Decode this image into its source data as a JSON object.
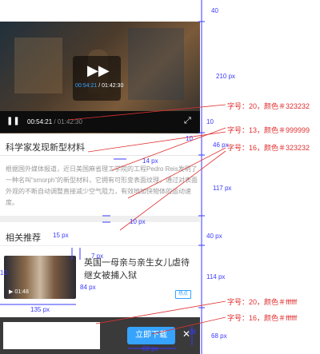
{
  "video": {
    "center_time_current": "00:54:21",
    "center_time_total": "01:42:30",
    "bar_time_current": "00:54:21",
    "bar_time_separator": " / ",
    "bar_time_total": "01:42:30",
    "play_icon": "play-icon",
    "pause_icon": "pause-icon",
    "fullscreen_icon": "fullscreen-icon",
    "progress_fraction": 0.45
  },
  "article": {
    "title": "科学家发现新型材料",
    "body": "根据国外媒体报道，近日美国麻省理工学院的工程Pedro Reis发明了一种名叫“smorph”的新型材料，它拥有可形变表面纹理，通过对表面外观的不断自动调整直接减少空气阻力，有效地加快物体的运动速度。"
  },
  "related": {
    "heading": "相关推荐",
    "item": {
      "title": "英国一母亲与亲生女儿虐待继女被捕入狱",
      "duration": "01:48",
      "tag": "热点"
    }
  },
  "bottom_bar": {
    "download_label": "立即下载",
    "close_icon": "close-icon"
  },
  "annotations": {
    "h40_top": "40",
    "h210": "210 px",
    "h10_a": "10",
    "h10_b": "10",
    "h46": "46 px",
    "h117": "117 px",
    "h10_c": "10 px",
    "h14": "14 px",
    "h40_mid": "40 px",
    "w15": "15 px",
    "w7": "7 px",
    "h114": "114 px",
    "w84": "84 px",
    "w10": "10",
    "w135": "135 px",
    "h68": "68 px",
    "h28": "28",
    "w88": "88 px",
    "spec1": "字号：20，颜色＃323232",
    "spec2": "字号：13，颜色＃999999",
    "spec3": "字号：16，颜色＃323232",
    "spec4": "字号：20，颜色＃ffffff",
    "spec5": "字号：16，颜色＃ffffff"
  },
  "colors": {
    "accent": "#36a3ff",
    "annotation_blue": "#3a3aff",
    "annotation_red": "#e03030",
    "title_text": "#323232",
    "body_text": "#999999"
  }
}
